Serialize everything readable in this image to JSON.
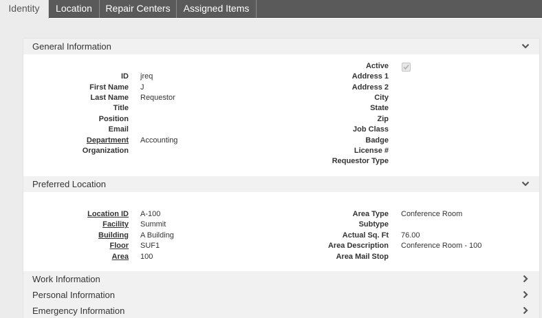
{
  "tabs": [
    {
      "label": "Identity",
      "active": true
    },
    {
      "label": "Location",
      "active": false
    },
    {
      "label": "Repair Centers",
      "active": false
    },
    {
      "label": "Assigned Items",
      "active": false
    }
  ],
  "general": {
    "title": "General Information",
    "left": [
      {
        "label": "ID",
        "value": "jreq",
        "link": false
      },
      {
        "label": "First Name",
        "value": "J",
        "link": false
      },
      {
        "label": "Last Name",
        "value": "Requestor",
        "link": false
      },
      {
        "label": "Title",
        "value": "",
        "link": false
      },
      {
        "label": "Position",
        "value": "",
        "link": false
      },
      {
        "label": "Email",
        "value": "",
        "link": false
      },
      {
        "label": "Department",
        "value": "Accounting",
        "link": true
      },
      {
        "label": "Organization",
        "value": "",
        "link": false
      }
    ],
    "right": [
      {
        "label": "Active",
        "value": "",
        "checkbox": true
      },
      {
        "label": "Address 1",
        "value": ""
      },
      {
        "label": "Address 2",
        "value": ""
      },
      {
        "label": "City",
        "value": ""
      },
      {
        "label": "State",
        "value": ""
      },
      {
        "label": "Zip",
        "value": ""
      },
      {
        "label": "Job Class",
        "value": ""
      },
      {
        "label": "Badge",
        "value": ""
      },
      {
        "label": "License #",
        "value": ""
      },
      {
        "label": "Requestor Type",
        "value": ""
      }
    ]
  },
  "preferred": {
    "title": "Preferred Location",
    "left": [
      {
        "label": "Location ID",
        "value": "A-100",
        "link": true
      },
      {
        "label": "Facility",
        "value": "Summit",
        "link": true
      },
      {
        "label": "Building",
        "value": "A Building",
        "link": true
      },
      {
        "label": "Floor",
        "value": "SUF1",
        "link": true
      },
      {
        "label": "Area",
        "value": "100",
        "link": true
      }
    ],
    "right": [
      {
        "label": "Area Type",
        "value": "Conference Room"
      },
      {
        "label": "Subtype",
        "value": ""
      },
      {
        "label": "Actual Sq. Ft",
        "value": "76.00"
      },
      {
        "label": "Area Description",
        "value": "Conference Room - 100"
      },
      {
        "label": "Area Mail Stop",
        "value": ""
      }
    ]
  },
  "collapsed_sections": [
    {
      "title": "Work Information"
    },
    {
      "title": "Personal Information"
    },
    {
      "title": "Emergency Information"
    }
  ],
  "icons": {
    "expanded": "chevron-down-icon",
    "collapsed": "chevron-right-icon"
  },
  "colors": {
    "tabbar": "#5a5a5a",
    "panel": "#ececec",
    "section_header": "#f1f1f1"
  }
}
